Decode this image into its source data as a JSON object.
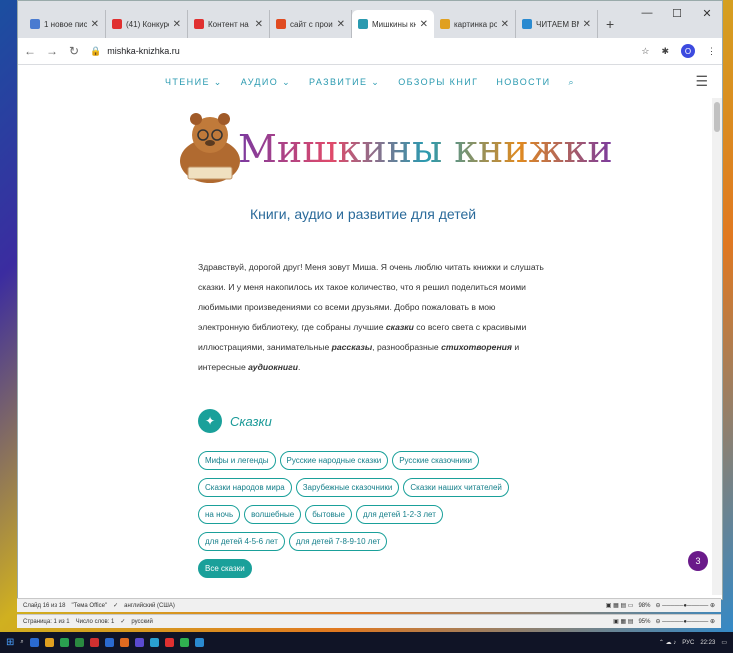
{
  "browser": {
    "tabs": [
      {
        "title": "1 новое письм",
        "color": "#4a7bd0",
        "active": false
      },
      {
        "title": "(41) Конкурс ",
        "color": "#e03030",
        "active": false
      },
      {
        "title": "Контент на ка",
        "color": "#e03030",
        "active": false
      },
      {
        "title": "сайт с произв",
        "color": "#e04a20",
        "active": false
      },
      {
        "title": "Мишкины книж",
        "color": "#2a9ab0",
        "active": true
      },
      {
        "title": "картинка роди",
        "color": "#e0a020",
        "active": false
      },
      {
        "title": "ЧИТАЕМ ВМЕС",
        "color": "#2a8ad0",
        "active": false
      }
    ],
    "new_tab": "+",
    "url": "mishka-knizhka.ru",
    "profile_letter": "O"
  },
  "site": {
    "nav": [
      "ЧТЕНИЕ ⌄",
      "АУДИО ⌄",
      "РАЗВИТИЕ ⌄",
      "ОБЗОРЫ КНИГ",
      "НОВОСТИ"
    ],
    "logo_text": "Мишкины книжки",
    "subtitle": "Книги, аудио и развитие для детей",
    "intro_parts": {
      "p1": "Здравствуй, дорогой друг! Меня зовут Миша. Я очень люблю читать книжки и слушать сказки. И у меня накопилось их такое количество, что я решил поделиться моими любимыми произведениями со всеми друзьями. Добро пожаловать в мою электронную библиотеку, где собраны лучшие ",
      "b1": "сказки",
      "p2": " со всего света с красивыми иллюстрациями, занимательные ",
      "b2": "рассказы",
      "p3": ", разнообразные ",
      "b3": "стихотворения",
      "p4": " и интересные ",
      "b4": "аудиокниги",
      "p5": "."
    },
    "section_title": "Сказки",
    "chip_rows": [
      [
        "Мифы и легенды",
        "Русские народные сказки",
        "Русские сказочники"
      ],
      [
        "Сказки народов мира",
        "Зарубежные сказочники",
        "Сказки наших читателей"
      ],
      [
        "на ночь",
        "волшебные",
        "бытовые",
        "для детей 1-2-3 лет"
      ],
      [
        "для детей 4-5-6 лет",
        "для детей 7-8-9-10 лет"
      ]
    ],
    "all_tales": "Все сказки",
    "badge_count": "3"
  },
  "office": {
    "slide_info": "Слайд 16 из 18",
    "theme": "\"Тема Office\"",
    "lang1": "английский (США)",
    "zoom1": "98%",
    "page_info": "Страница: 1 из 1",
    "word_count": "Число слов: 1",
    "lang2": "русский",
    "zoom2": "95%"
  },
  "taskbar": {
    "lang": "РУС",
    "time": "22:23"
  }
}
